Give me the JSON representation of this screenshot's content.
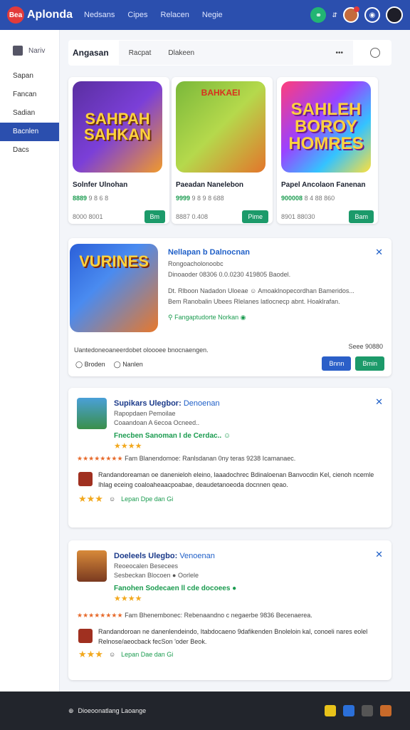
{
  "app": {
    "logo_badge": "Bea",
    "name": "Aplonda"
  },
  "topnav": [
    "Nedsans",
    "Cipes",
    "Relacen",
    "Negie"
  ],
  "sidebar": {
    "header": "Nariv",
    "items": [
      {
        "label": "Sapan",
        "active": false
      },
      {
        "label": "Fancan",
        "active": false
      },
      {
        "label": "Sadian",
        "active": false
      },
      {
        "label": "Bacnlen",
        "active": true
      },
      {
        "label": "Dacs",
        "active": false
      }
    ]
  },
  "main_header": {
    "title": "Angasan",
    "tabs": [
      "Racpat",
      "Dlakeen"
    ],
    "more": "•••"
  },
  "cards": [
    {
      "art": "SAHPAH SAHKAN",
      "name": "Solnfer Ulnohan",
      "rating": "8889",
      "rating_sub": "9 8 6 8",
      "size": "8000 8001",
      "button": "Bm"
    },
    {
      "art": "BAHKAEI",
      "name": "Paeadan Nanelebon",
      "rating": "9999",
      "rating_sub": "9 8 9 8 688",
      "size": "8887 0.408",
      "button": "Pime"
    },
    {
      "art": "SAHLEH BOROY HOMRES",
      "name": "Papel Ancolaon Fanenan",
      "rating": "900008",
      "rating_sub": "8 4 88 860",
      "size": "8901 88030",
      "button": "Bam"
    }
  ],
  "featured": {
    "art": "VURINES",
    "title": "Nellapan b Dalnocnan",
    "line1": "Rongoacholonoobc",
    "line2": "Dinoaoder 08306 0.0.0230 419805 Baodel.",
    "line3": "Dt. Rlboon  Nadadon  Uloeae  ☺  Amoaklnopecordhan Bameridos...",
    "line4": "Bem  Ranobalin  Ubees  Rlelanes  latlocnecp abnt. Hoaklrafan.",
    "link": "Fangaptudorte Norkan",
    "bottom_text": "Uantedoneoaneerdobet oloooee bnocnaengen.",
    "size": "Seee 90880",
    "meta1": "Broden",
    "meta2": "Nanlen",
    "btn1": "Bnnn",
    "btn2": "Bmin"
  },
  "reviews": [
    {
      "title": "Supikars Ulegbor:",
      "accent": "Denoenan",
      "sub1": "Rapopdaen Pemoilae",
      "sub2": "Coaandoan A 6ecoa Ocneed..",
      "highlight": "Fnecben  Sanoman  I de Cerdac..  ☺",
      "stars": "★★★★",
      "row_stars": "★★★★★★★★",
      "row_text": "Fam Blanendomoe: Ranlsdanan 0ny teras 9238 Icamanaec.",
      "comment": "Randandoreaman oe danenieloh eleino, laaadochrec Bdinaloenan Banvocdin Kel, cienoh ncemle Ihlag eceing coaloaheaacpoabae, deaudetanoeoda docnnen qeao.",
      "foot_link": "Lepan  Dpe dan Gi"
    },
    {
      "title": "Doeleels Ulegbo:",
      "accent": "Venoenan",
      "sub1": "Reoeocalen Besecees",
      "sub2": "Sesbeckan  Blocoen  ●  Oorlele",
      "highlight": "Fanohen  Sodecaen ll cde docoees  ●",
      "stars": "★★★★",
      "row_stars": "★★★★★★★★",
      "row_text": "Fam Bhenembonec: Rebenaandno c negaerbe 9836 Becenaerea.",
      "comment": "Randandoroan ne danenlendeindo, Itabdocaeno 9dafikenden Bnoleloin kal, conoeli nares eolel Relnose/aeocback fecSon 'oder Beok.",
      "foot_link": "Lepan  Dae dan Gi"
    }
  ],
  "footer": {
    "language": "Dioeoonatlang Laoange"
  }
}
